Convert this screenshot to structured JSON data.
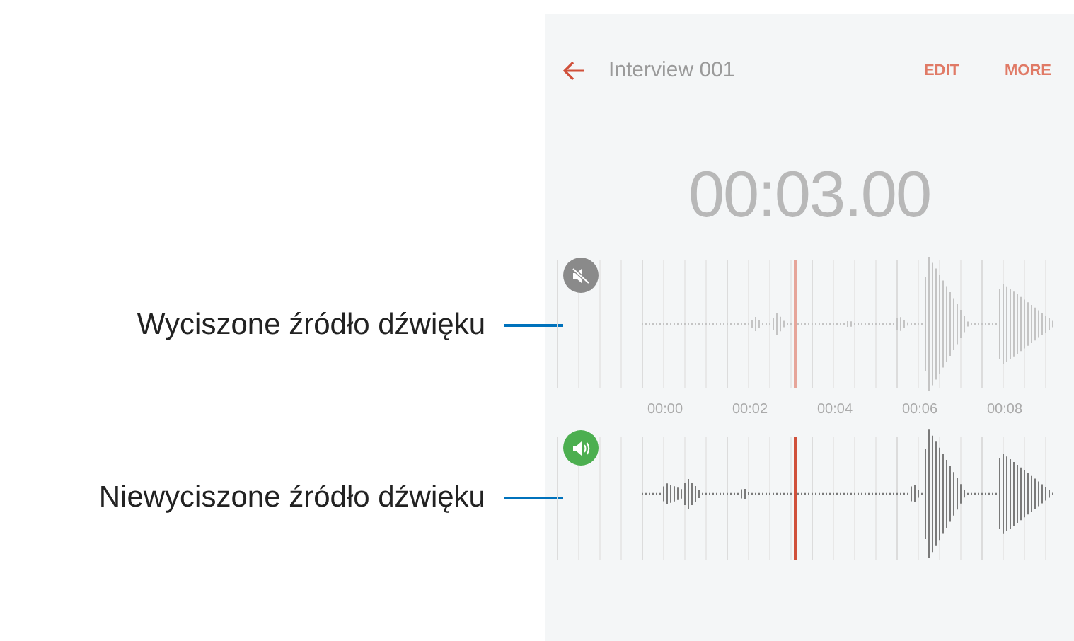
{
  "header": {
    "title": "Interview 001",
    "actions": [
      "EDIT",
      "MORE"
    ]
  },
  "timer": "00:03.00",
  "tracks": [
    {
      "callout": "Wyciszone źródło dźwięku",
      "muted": true
    },
    {
      "callout": "Niewyciszone źródło dźwięku",
      "muted": false
    }
  ],
  "timeline": [
    "00:00",
    "00:02",
    "00:04",
    "00:06",
    "00:08"
  ]
}
